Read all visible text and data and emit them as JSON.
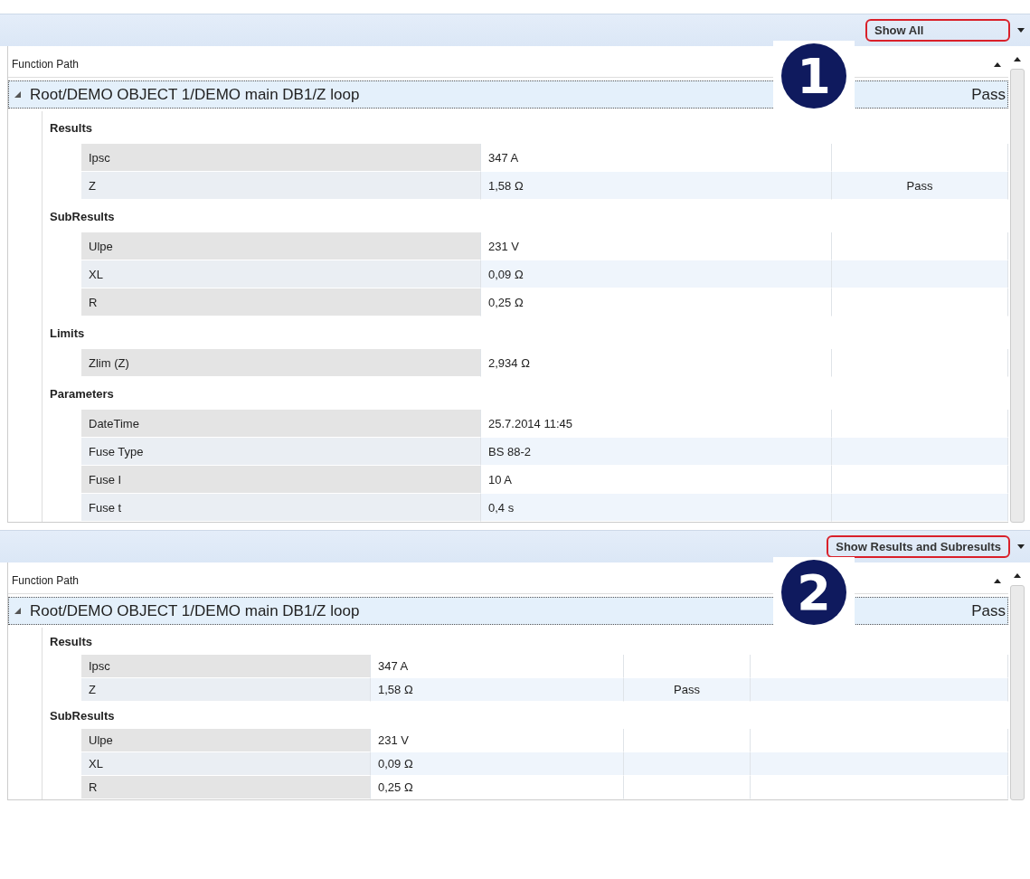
{
  "panels": [
    {
      "filter": "Show All",
      "badge": "1",
      "header": "Function Path",
      "group": {
        "path": "Root/DEMO OBJECT 1/DEMO main DB1/Z loop",
        "status": "Pass",
        "expanded": true
      },
      "sections": [
        {
          "title": "Results",
          "rows": [
            {
              "cells": [
                "Ipsc",
                "347 A"
              ]
            },
            {
              "cells": [
                "Z",
                "1,58 Ω",
                "Pass"
              ]
            }
          ]
        },
        {
          "title": "SubResults",
          "rows": [
            {
              "cells": [
                "Ulpe",
                "231 V"
              ]
            },
            {
              "cells": [
                "XL",
                "0,09 Ω"
              ]
            },
            {
              "cells": [
                "R",
                "0,25 Ω"
              ]
            }
          ]
        },
        {
          "title": "Limits",
          "rows": [
            {
              "cells": [
                "Zlim  (Z)",
                "2,934 Ω"
              ]
            }
          ]
        },
        {
          "title": "Parameters",
          "rows": [
            {
              "cells": [
                "DateTime",
                "25.7.2014 11:45"
              ]
            },
            {
              "cells": [
                "Fuse Type",
                "BS 88-2"
              ]
            },
            {
              "cells": [
                "Fuse I",
                "10 A"
              ]
            },
            {
              "cells": [
                "Fuse t",
                "0,4 s"
              ]
            }
          ]
        }
      ]
    },
    {
      "filter": "Show Results and Subresults",
      "badge": "2",
      "header": "Function Path",
      "group": {
        "path": "Root/DEMO OBJECT 1/DEMO main DB1/Z loop",
        "status": "Pass",
        "expanded": true
      },
      "sections": [
        {
          "title": "Results",
          "rows": [
            {
              "cells": [
                "Ipsc",
                "347 A"
              ]
            },
            {
              "cells": [
                "Z",
                "1,58 Ω",
                "Pass"
              ]
            }
          ]
        },
        {
          "title": "SubResults",
          "rows": [
            {
              "cells": [
                "Ulpe",
                "231 V"
              ]
            },
            {
              "cells": [
                "XL",
                "0,09 Ω"
              ]
            },
            {
              "cells": [
                "R",
                "0,25 Ω"
              ]
            }
          ]
        }
      ]
    }
  ]
}
